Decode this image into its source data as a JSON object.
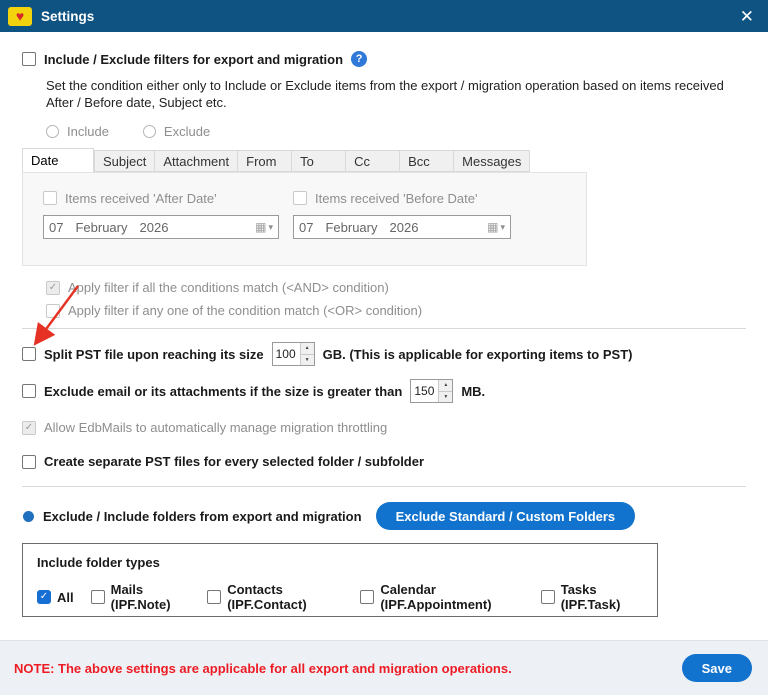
{
  "titlebar": {
    "title": "Settings"
  },
  "icons": {
    "close": "✕",
    "help": "?",
    "heart": "♥",
    "calendar": "▦",
    "dropdown": "▾",
    "spin_up": "▲",
    "spin_down": "▼",
    "check": "✓"
  },
  "filters": {
    "label": "Include / Exclude filters for export and migration",
    "description": "Set the condition either only to Include or Exclude items from the export / migration operation based on items received After / Before date, Subject etc.",
    "radio_include": "Include",
    "radio_exclude": "Exclude",
    "tabs": [
      "Date",
      "Subject",
      "Attachment",
      "From",
      "To",
      "Cc",
      "Bcc",
      "Messages"
    ],
    "active_tab": "Date",
    "after_checkbox": "Items received 'After Date'",
    "before_checkbox": "Items received 'Before Date'",
    "after_date": {
      "day": "07",
      "month": "February",
      "year": "2026"
    },
    "before_date": {
      "day": "07",
      "month": "February",
      "year": "2026"
    },
    "and_condition": "Apply filter if all the conditions match (<AND> condition)",
    "or_condition": "Apply filter if any one of the condition match (<OR> condition)"
  },
  "options": {
    "split_pst_prefix": "Split PST file upon reaching its size",
    "split_pst_value": "100",
    "split_pst_suffix": "GB. (This is applicable for exporting items to PST)",
    "exclude_email_prefix": "Exclude email or its attachments if the size is greater than",
    "exclude_email_value": "150",
    "exclude_email_suffix": "MB.",
    "throttling": "Allow EdbMails to automatically manage migration throttling",
    "separate_pst": "Create separate PST files for every selected folder / subfolder"
  },
  "folders": {
    "radio_label": "Exclude / Include folders from export and migration",
    "button_label": "Exclude Standard / Custom Folders",
    "box_title": "Include folder types",
    "types": [
      {
        "label": "All",
        "checked": true
      },
      {
        "label": "Mails (IPF.Note)",
        "checked": false
      },
      {
        "label": "Contacts (IPF.Contact)",
        "checked": false
      },
      {
        "label": "Calendar (IPF.Appointment)",
        "checked": false
      },
      {
        "label": "Tasks (IPF.Task)",
        "checked": false
      }
    ]
  },
  "footer": {
    "note": "NOTE: The above settings are applicable for all export and migration operations.",
    "save_label": "Save"
  },
  "colors": {
    "titlebar": "#0f5382",
    "accent_blue": "#1173cd",
    "note_red": "#ed1c24",
    "arrow_red": "#e53224"
  }
}
